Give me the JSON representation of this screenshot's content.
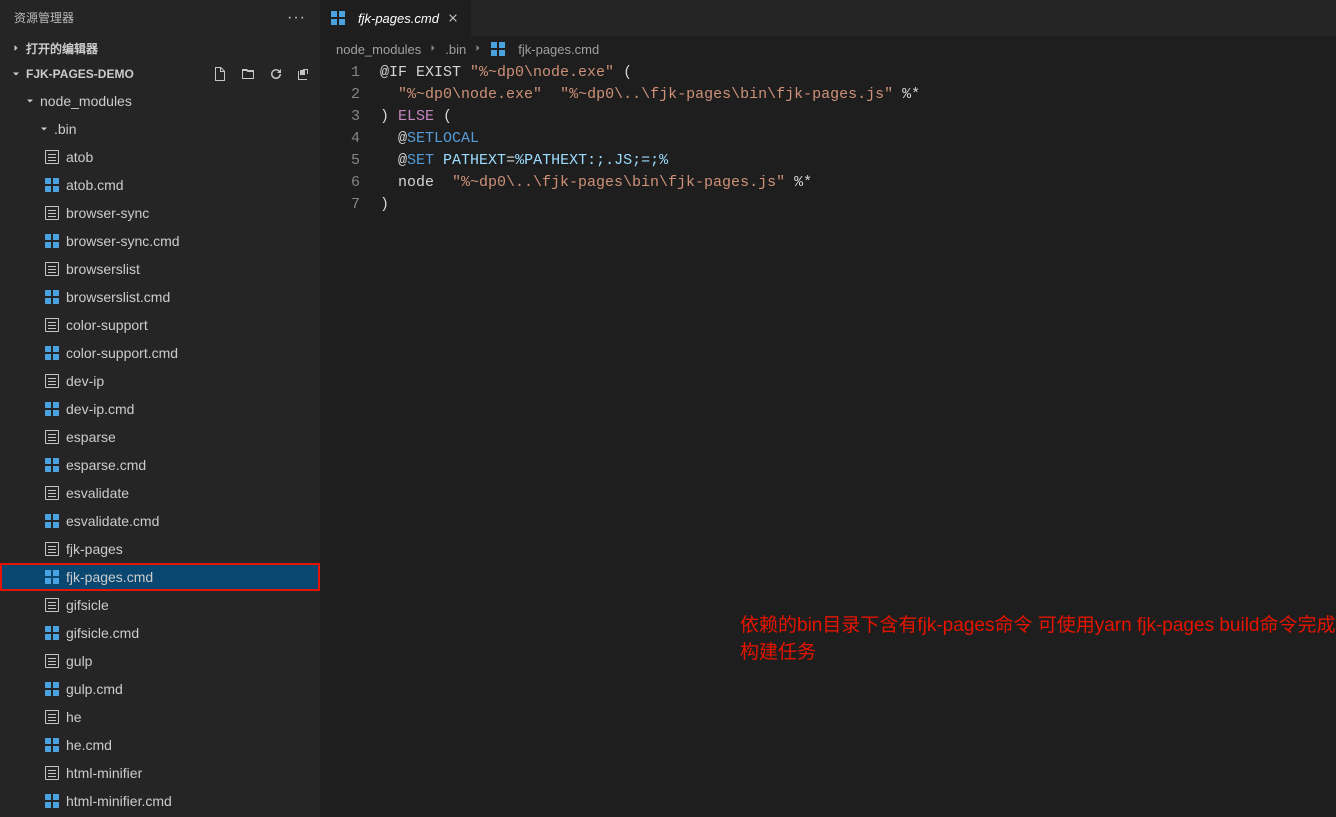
{
  "sidebar": {
    "title": "资源管理器",
    "sections": {
      "open_editors": "打开的编辑器",
      "project": "FJK-PAGES-DEMO"
    },
    "folders": {
      "node_modules": "node_modules",
      "bin": ".bin"
    },
    "files": [
      {
        "name": "atob",
        "icon": "text"
      },
      {
        "name": "atob.cmd",
        "icon": "win"
      },
      {
        "name": "browser-sync",
        "icon": "text"
      },
      {
        "name": "browser-sync.cmd",
        "icon": "win"
      },
      {
        "name": "browserslist",
        "icon": "text"
      },
      {
        "name": "browserslist.cmd",
        "icon": "win"
      },
      {
        "name": "color-support",
        "icon": "text"
      },
      {
        "name": "color-support.cmd",
        "icon": "win"
      },
      {
        "name": "dev-ip",
        "icon": "text"
      },
      {
        "name": "dev-ip.cmd",
        "icon": "win"
      },
      {
        "name": "esparse",
        "icon": "text"
      },
      {
        "name": "esparse.cmd",
        "icon": "win"
      },
      {
        "name": "esvalidate",
        "icon": "text"
      },
      {
        "name": "esvalidate.cmd",
        "icon": "win"
      },
      {
        "name": "fjk-pages",
        "icon": "text"
      },
      {
        "name": "fjk-pages.cmd",
        "icon": "win",
        "selected": true
      },
      {
        "name": "gifsicle",
        "icon": "text"
      },
      {
        "name": "gifsicle.cmd",
        "icon": "win"
      },
      {
        "name": "gulp",
        "icon": "text"
      },
      {
        "name": "gulp.cmd",
        "icon": "win"
      },
      {
        "name": "he",
        "icon": "text"
      },
      {
        "name": "he.cmd",
        "icon": "win"
      },
      {
        "name": "html-minifier",
        "icon": "text"
      },
      {
        "name": "html-minifier.cmd",
        "icon": "win"
      }
    ]
  },
  "tab": {
    "label": "fjk-pages.cmd"
  },
  "breadcrumbs": [
    "node_modules",
    ".bin",
    "fjk-pages.cmd"
  ],
  "code": {
    "lines": [
      {
        "n": 1,
        "tokens": [
          {
            "t": "@IF",
            "c": "white"
          },
          {
            "t": " EXIST ",
            "c": "white"
          },
          {
            "t": "\"%~dp0\\node.exe\"",
            "c": "orange"
          },
          {
            "t": " (",
            "c": "white"
          }
        ]
      },
      {
        "n": 2,
        "tokens": [
          {
            "t": "  ",
            "c": "white"
          },
          {
            "t": "\"%~dp0\\node.exe\"",
            "c": "orange"
          },
          {
            "t": "  ",
            "c": "white"
          },
          {
            "t": "\"%~dp0\\..\\fjk-pages\\bin\\fjk-pages.js\"",
            "c": "orange"
          },
          {
            "t": " %*",
            "c": "white"
          }
        ]
      },
      {
        "n": 3,
        "tokens": [
          {
            "t": ") ",
            "c": "white"
          },
          {
            "t": "ELSE",
            "c": "pink"
          },
          {
            "t": " (",
            "c": "white"
          }
        ]
      },
      {
        "n": 4,
        "tokens": [
          {
            "t": "  @",
            "c": "white"
          },
          {
            "t": "SETLOCAL",
            "c": "blue"
          }
        ]
      },
      {
        "n": 5,
        "tokens": [
          {
            "t": "  @",
            "c": "white"
          },
          {
            "t": "SET",
            "c": "blue"
          },
          {
            "t": " ",
            "c": "white"
          },
          {
            "t": "PATHEXT",
            "c": "cyan"
          },
          {
            "t": "=",
            "c": "white"
          },
          {
            "t": "%PATHEXT:;.JS;=;%",
            "c": "cyan"
          }
        ]
      },
      {
        "n": 6,
        "tokens": [
          {
            "t": "  node  ",
            "c": "white"
          },
          {
            "t": "\"%~dp0\\..\\fjk-pages\\bin\\fjk-pages.js\"",
            "c": "orange"
          },
          {
            "t": " %*",
            "c": "white"
          }
        ]
      },
      {
        "n": 7,
        "tokens": [
          {
            "t": ")",
            "c": "white"
          }
        ]
      }
    ]
  },
  "annotation": "依赖的bin目录下含有fjk-pages命令 可使用yarn fjk-pages build命令完成构建任务"
}
